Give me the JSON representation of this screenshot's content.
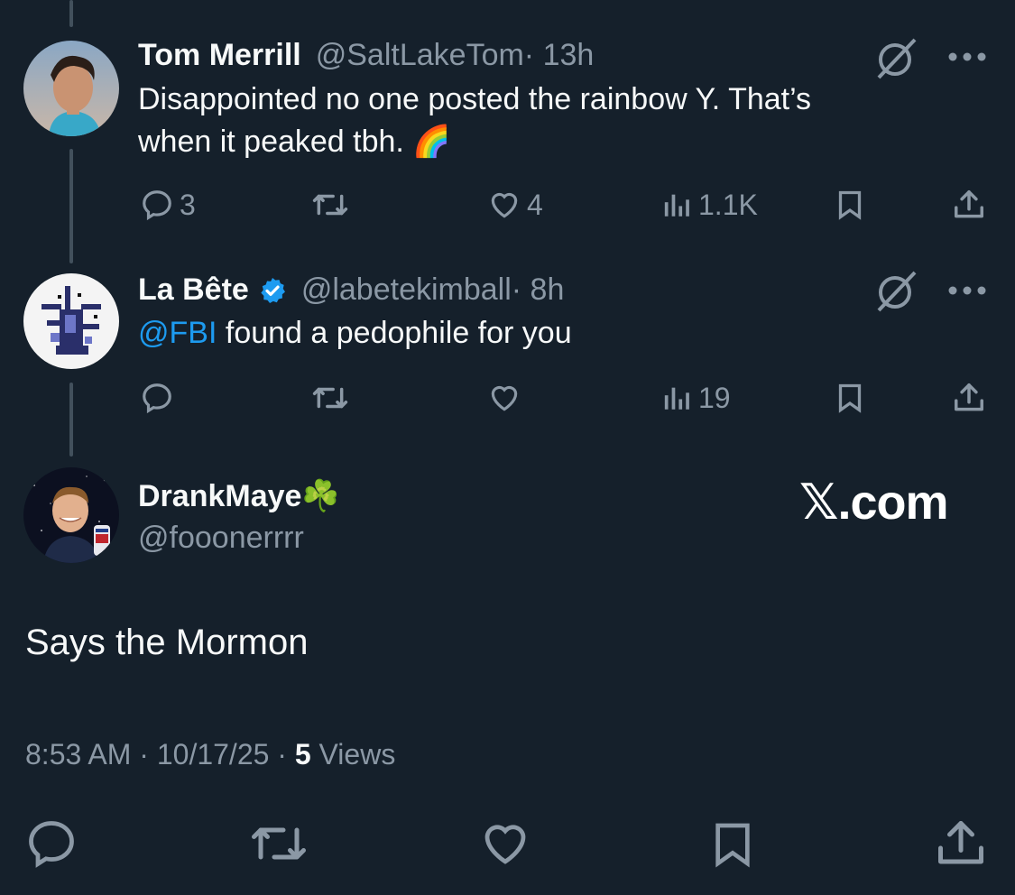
{
  "tweets": [
    {
      "name": "Tom Merrill",
      "handle": "@SaltLakeTom",
      "time": " · 13h",
      "text_line1": "Disappointed no one posted the rainbow Y. That’s",
      "text_line2": "when it peaked tbh. 🌈",
      "replies": "3",
      "retweets": "",
      "likes": "4",
      "views": "1.1K"
    },
    {
      "name": "La Bête",
      "handle": "@labetekimball",
      "time": " · 8h",
      "mention": "@FBI",
      "text": " found a pedophile for you",
      "replies": "",
      "retweets": "",
      "likes": "",
      "views": "19",
      "verified": true
    }
  ],
  "main": {
    "name": "DrankMaye☘️",
    "handle": "@fooonerrrr",
    "text": "Says the Mormon",
    "time": "8:53 AM",
    "date": "10/17/25",
    "views_count": "5",
    "views_label": "Views"
  },
  "watermark": "𝕏.com",
  "colors": {
    "background": "#15202b",
    "accent": "#1d9bf0",
    "muted": "#8b98a5",
    "text": "#f7f9f9"
  },
  "icons": [
    "reply-icon",
    "retweet-icon",
    "like-icon",
    "views-icon",
    "bookmark-icon",
    "share-icon",
    "grok-icon",
    "more-icon",
    "verified-badge-icon"
  ]
}
